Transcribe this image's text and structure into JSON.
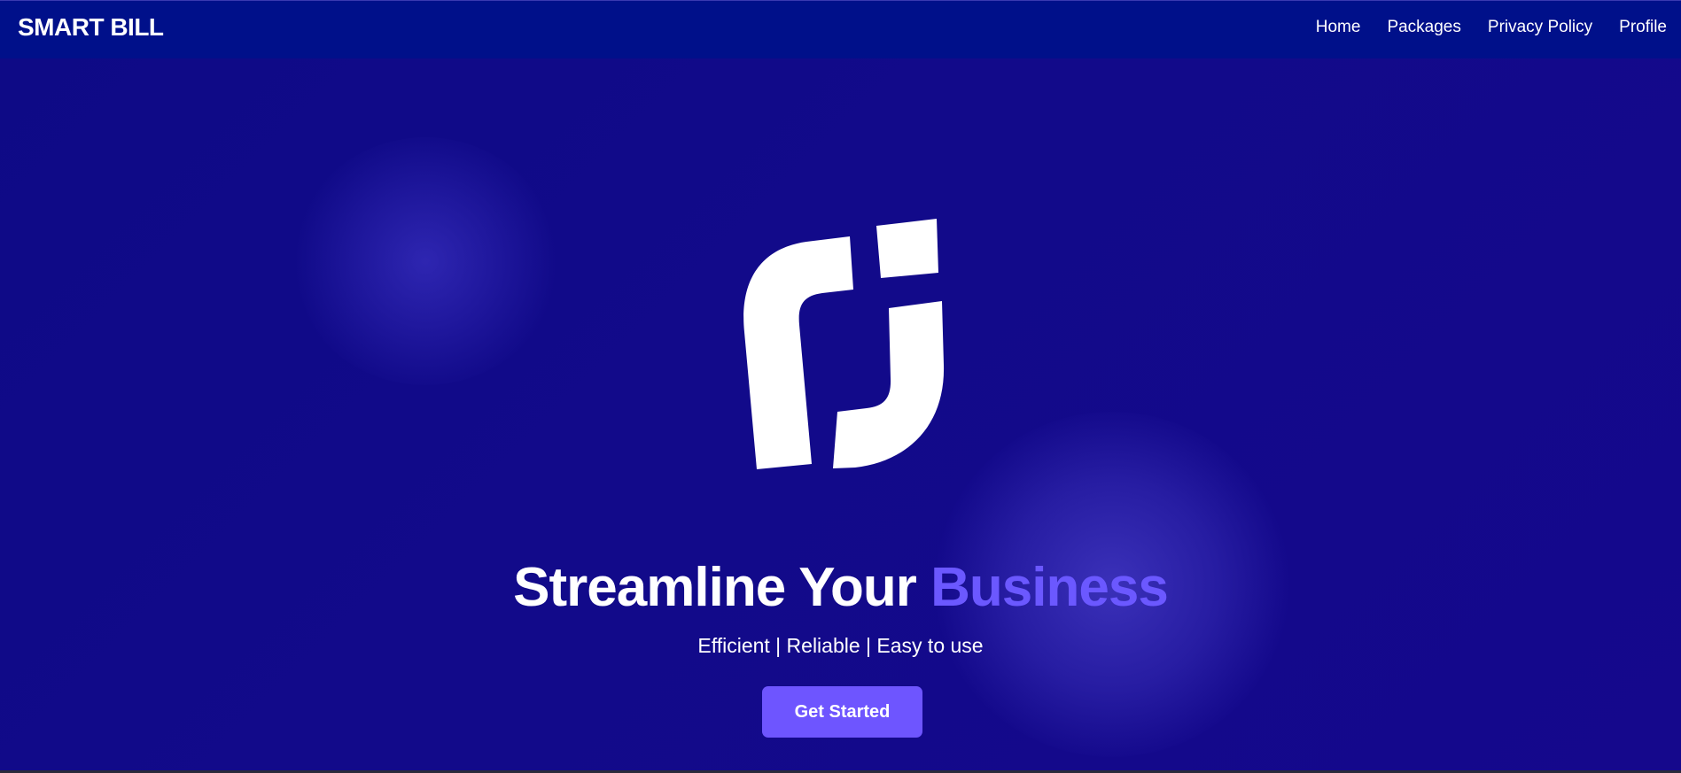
{
  "navbar": {
    "brand": "SMART BILL",
    "links": [
      "Home",
      "Packages",
      "Privacy Policy",
      "Profile"
    ]
  },
  "hero": {
    "logo_icon": "smart-bill-logo-icon",
    "title_main": "Streamline Your ",
    "title_accent": "Business",
    "subtitle": "Efficient | Reliable | Easy to use",
    "cta_label": "Get Started"
  },
  "colors": {
    "background": "#110a86",
    "navbar": "#00108a",
    "accent": "#6b58ff",
    "button": "#6e55ff",
    "text": "#ffffff"
  }
}
